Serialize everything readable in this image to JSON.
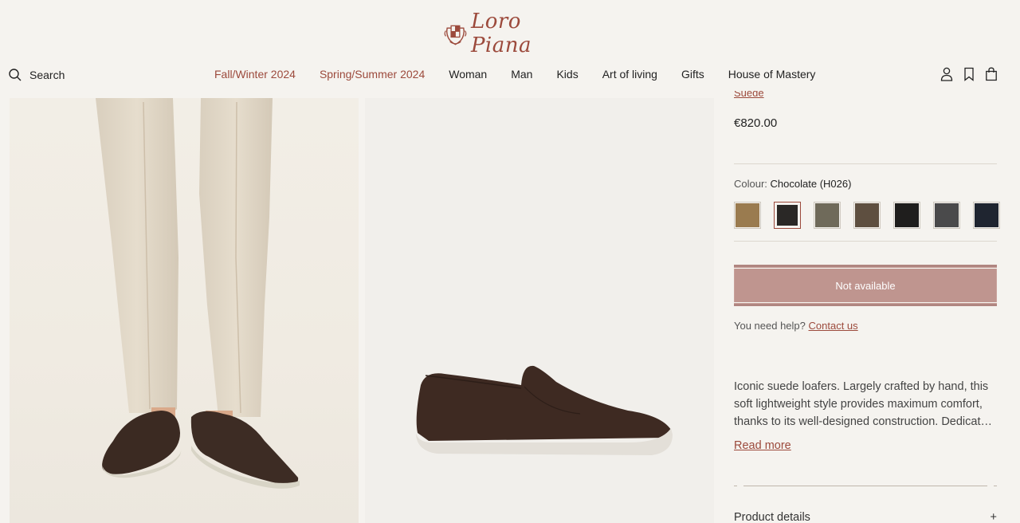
{
  "brand": {
    "name": "Loro Piana"
  },
  "search": {
    "label": "Search"
  },
  "nav": {
    "items": [
      {
        "label": "Fall/Winter 2024",
        "accent": true
      },
      {
        "label": "Spring/Summer 2024",
        "accent": true
      },
      {
        "label": "Woman"
      },
      {
        "label": "Man"
      },
      {
        "label": "Kids"
      },
      {
        "label": "Art of living"
      },
      {
        "label": "Gifts"
      },
      {
        "label": "House of Mastery"
      }
    ]
  },
  "header_icons": [
    "account-icon",
    "wishlist-bookmark-icon",
    "shopping-bag-icon"
  ],
  "product": {
    "material": "Suede",
    "price": "€820.00",
    "colour_label": "Colour:",
    "colour_value": "Chocolate (H026)",
    "swatches": [
      {
        "color": "#9a7b4f",
        "selected": false
      },
      {
        "color": "#2a2826",
        "selected": true
      },
      {
        "color": "#6f6a5a",
        "selected": false
      },
      {
        "color": "#5e4f40",
        "selected": false
      },
      {
        "color": "#1f1e1d",
        "selected": false
      },
      {
        "color": "#4a4a4b",
        "selected": false
      },
      {
        "color": "#1f2530",
        "selected": false
      }
    ],
    "availability_button": "Not available",
    "help_text": "You need help?",
    "help_link": "Contact us",
    "description": "Iconic suede loafers. Largely crafted by hand, this soft lightweight style provides maximum comfort, thanks to its well-designed construction. Dedicat…",
    "read_more": "Read more",
    "details_label": "Product details",
    "details_toggle": "+"
  },
  "colors": {
    "accent": "#9c4a3c",
    "button": "#bf958f",
    "background": "#f5f3ef"
  }
}
